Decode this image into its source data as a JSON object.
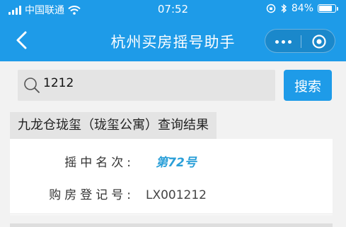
{
  "status_bar": {
    "carrier": "中国联通",
    "time": "07:52",
    "battery": "84%",
    "battery_level": 0.84
  },
  "nav": {
    "title": "杭州买房摇号助手"
  },
  "search": {
    "value": "1212",
    "button_label": "搜索"
  },
  "result": {
    "title": "九龙仓珑玺（珑玺公寓）查询结果",
    "rows": [
      {
        "label": "摇中名次:",
        "value": "第72号"
      },
      {
        "label": "购房登记号:",
        "value": "LX001212"
      }
    ]
  },
  "colors": {
    "brand": "#1e9be8",
    "highlight": "#2a9fd8"
  }
}
